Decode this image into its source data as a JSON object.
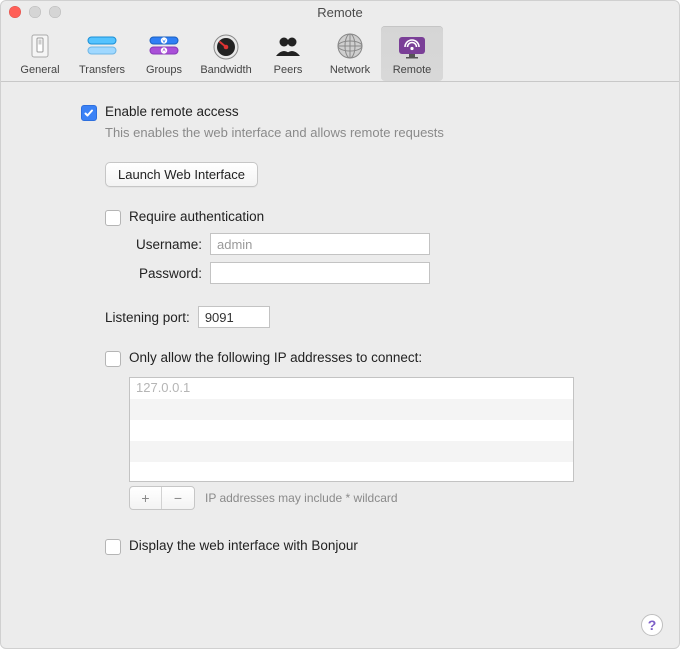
{
  "window": {
    "title": "Remote"
  },
  "toolbar": {
    "items": [
      {
        "label": "General"
      },
      {
        "label": "Transfers"
      },
      {
        "label": "Groups"
      },
      {
        "label": "Bandwidth"
      },
      {
        "label": "Peers"
      },
      {
        "label": "Network"
      },
      {
        "label": "Remote"
      }
    ],
    "selected": "Remote"
  },
  "remote": {
    "enable_label": "Enable remote access",
    "enable_checked": true,
    "enable_hint": "This enables the web interface and allows remote requests",
    "launch_button": "Launch Web Interface",
    "auth": {
      "require_label": "Require authentication",
      "require_checked": false,
      "username_label": "Username:",
      "username_value": "admin",
      "password_label": "Password:",
      "password_value": ""
    },
    "port_label": "Listening port:",
    "port_value": "9091",
    "whitelist": {
      "label": "Only allow the following IP addresses to connect:",
      "checked": false,
      "entries": [
        "127.0.0.1"
      ],
      "note": "IP addresses may include * wildcard"
    },
    "bonjour_label": "Display the web interface with Bonjour",
    "bonjour_checked": false
  },
  "help_label": "?"
}
